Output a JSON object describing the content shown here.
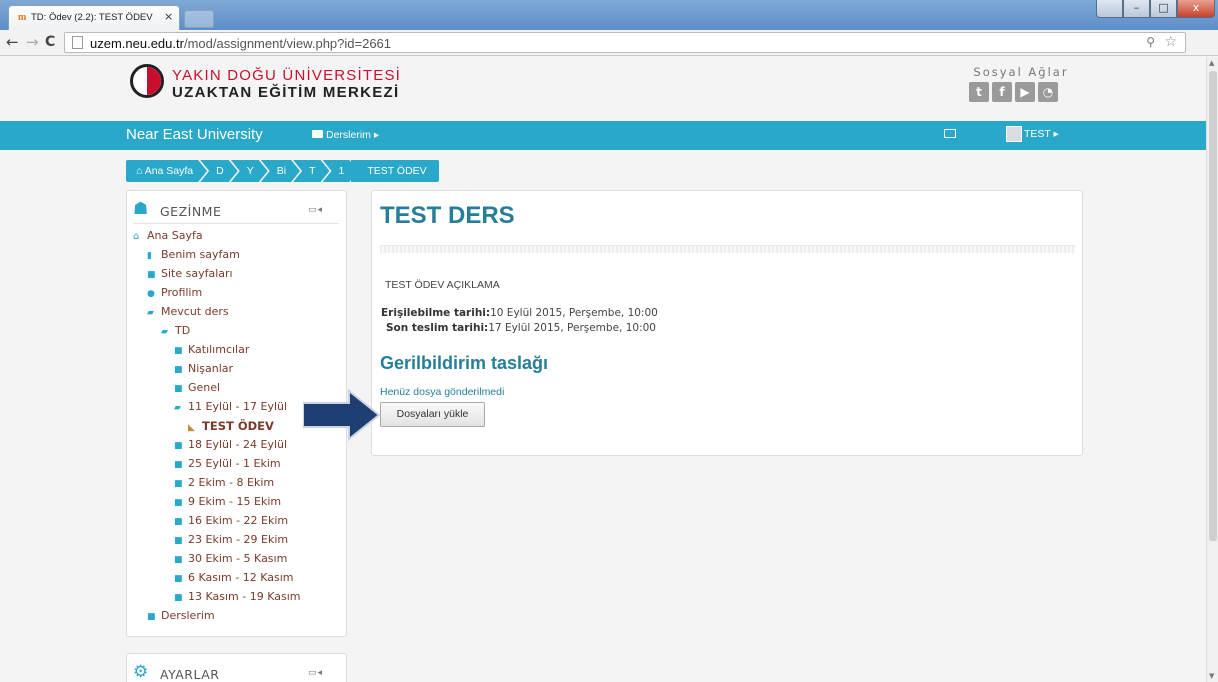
{
  "browser": {
    "tab_title": "TD: Ödev (2.2): TEST ÖDEV",
    "tab_close": "×",
    "url_host": "uzem.neu.edu.tr",
    "url_path": "/mod/assignment/view.php?id=2661",
    "window_buttons": {
      "min": "–",
      "max": "□",
      "close": "x"
    }
  },
  "header": {
    "uni_line1": "YAKIN DOĞU ÜNİVERSİTESİ",
    "uni_line2": "UZAKTAN EĞİTİM MERKEZİ",
    "social_title": "Sosyal Ağlar",
    "social_icons": [
      "twitter-icon",
      "facebook-icon",
      "youtube-icon",
      "blog-icon"
    ]
  },
  "navbar": {
    "brand": "Near East University",
    "courses": "Derslerim ▸",
    "user": "TEST ▸"
  },
  "breadcrumb": [
    "Ana Sayfa",
    "D",
    "Y",
    "Bi",
    "T",
    "1",
    "TEST ÖDEV"
  ],
  "navigation": {
    "title": "GEZİNME",
    "controls": "▭◂",
    "items": [
      "Ana Sayfa",
      "Benim sayfam",
      "Site sayfaları",
      "Profilim",
      "Mevcut ders",
      "TD",
      "Katılımcılar",
      "Nişanlar",
      "Genel",
      "11 Eylül - 17 Eylül",
      "TEST ÖDEV",
      "18 Eylül - 24 Eylül",
      "25 Eylül - 1 Ekim",
      "2 Ekim - 8 Ekim",
      "9 Ekim - 15 Ekim",
      "16 Ekim - 22 Ekim",
      "23 Ekim - 29 Ekim",
      "30 Ekim - 5 Kasım",
      "6 Kasım - 12 Kasım",
      "13 Kasım - 19 Kasım",
      "Derslerim"
    ]
  },
  "settings": {
    "title": "AYARLAR",
    "controls": "▭◂"
  },
  "main": {
    "heading": "TEST DERS",
    "description": "TEST ÖDEV AÇIKLAMA",
    "available_label": "Erişilebilme tarihi:",
    "available_value": "10 Eylül 2015, Perşembe, 10:00",
    "due_label": "Son teslim tarihi:",
    "due_value": "17 Eylül 2015, Perşembe, 10:00",
    "feedback_heading": "Gerilbildirim taslağı",
    "no_files": "Henüz dosya gönderilmedi",
    "upload_button": "Dosyaları yükle"
  },
  "colors": {
    "accent": "#2aa8c9",
    "heading": "#267e98",
    "brand_red": "#c8102e",
    "arrow": "#1f3f73"
  }
}
